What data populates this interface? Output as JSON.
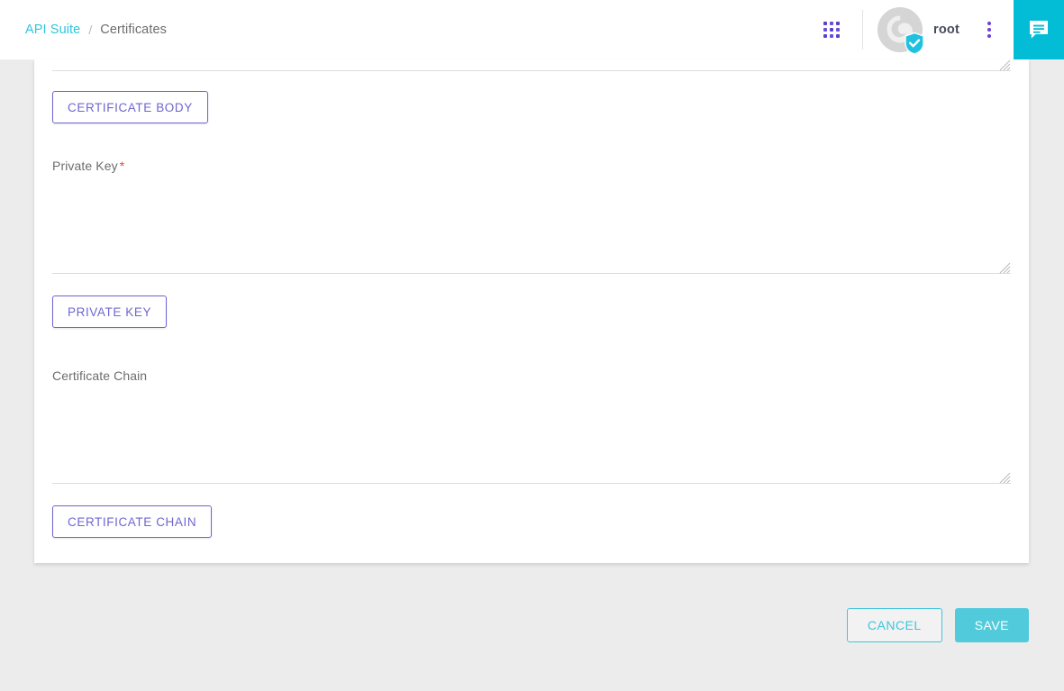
{
  "header": {
    "breadcrumb": {
      "root_label": "API Suite",
      "separator": "/",
      "current_label": "Certificates"
    },
    "apps_icon_name": "apps-grid-icon",
    "avatar_icon_name": "user-avatar",
    "shield_badge_name": "verified-shield-icon",
    "username": "root",
    "kebab_menu_name": "more-options-icon",
    "chat_icon_name": "chat-bubble-icon",
    "colors": {
      "accent_teal": "#03bdd7",
      "breadcrumb_link": "#2ec5de",
      "apps_purple": "#5b3fd4"
    }
  },
  "form": {
    "certificate_body": {
      "value": "",
      "placeholder": "",
      "button_label": "CERTIFICATE BODY"
    },
    "private_key": {
      "label": "Private Key",
      "required_marker": "*",
      "value": "",
      "placeholder": "",
      "button_label": "PRIVATE KEY"
    },
    "certificate_chain": {
      "label": "Certificate Chain",
      "value": "",
      "placeholder": "",
      "button_label": "CERTIFICATE CHAIN"
    }
  },
  "footer": {
    "cancel_label": "CANCEL",
    "save_label": "SAVE",
    "colors": {
      "cancel_border": "#3fc5dd",
      "save_background": "#51cbdb"
    }
  }
}
